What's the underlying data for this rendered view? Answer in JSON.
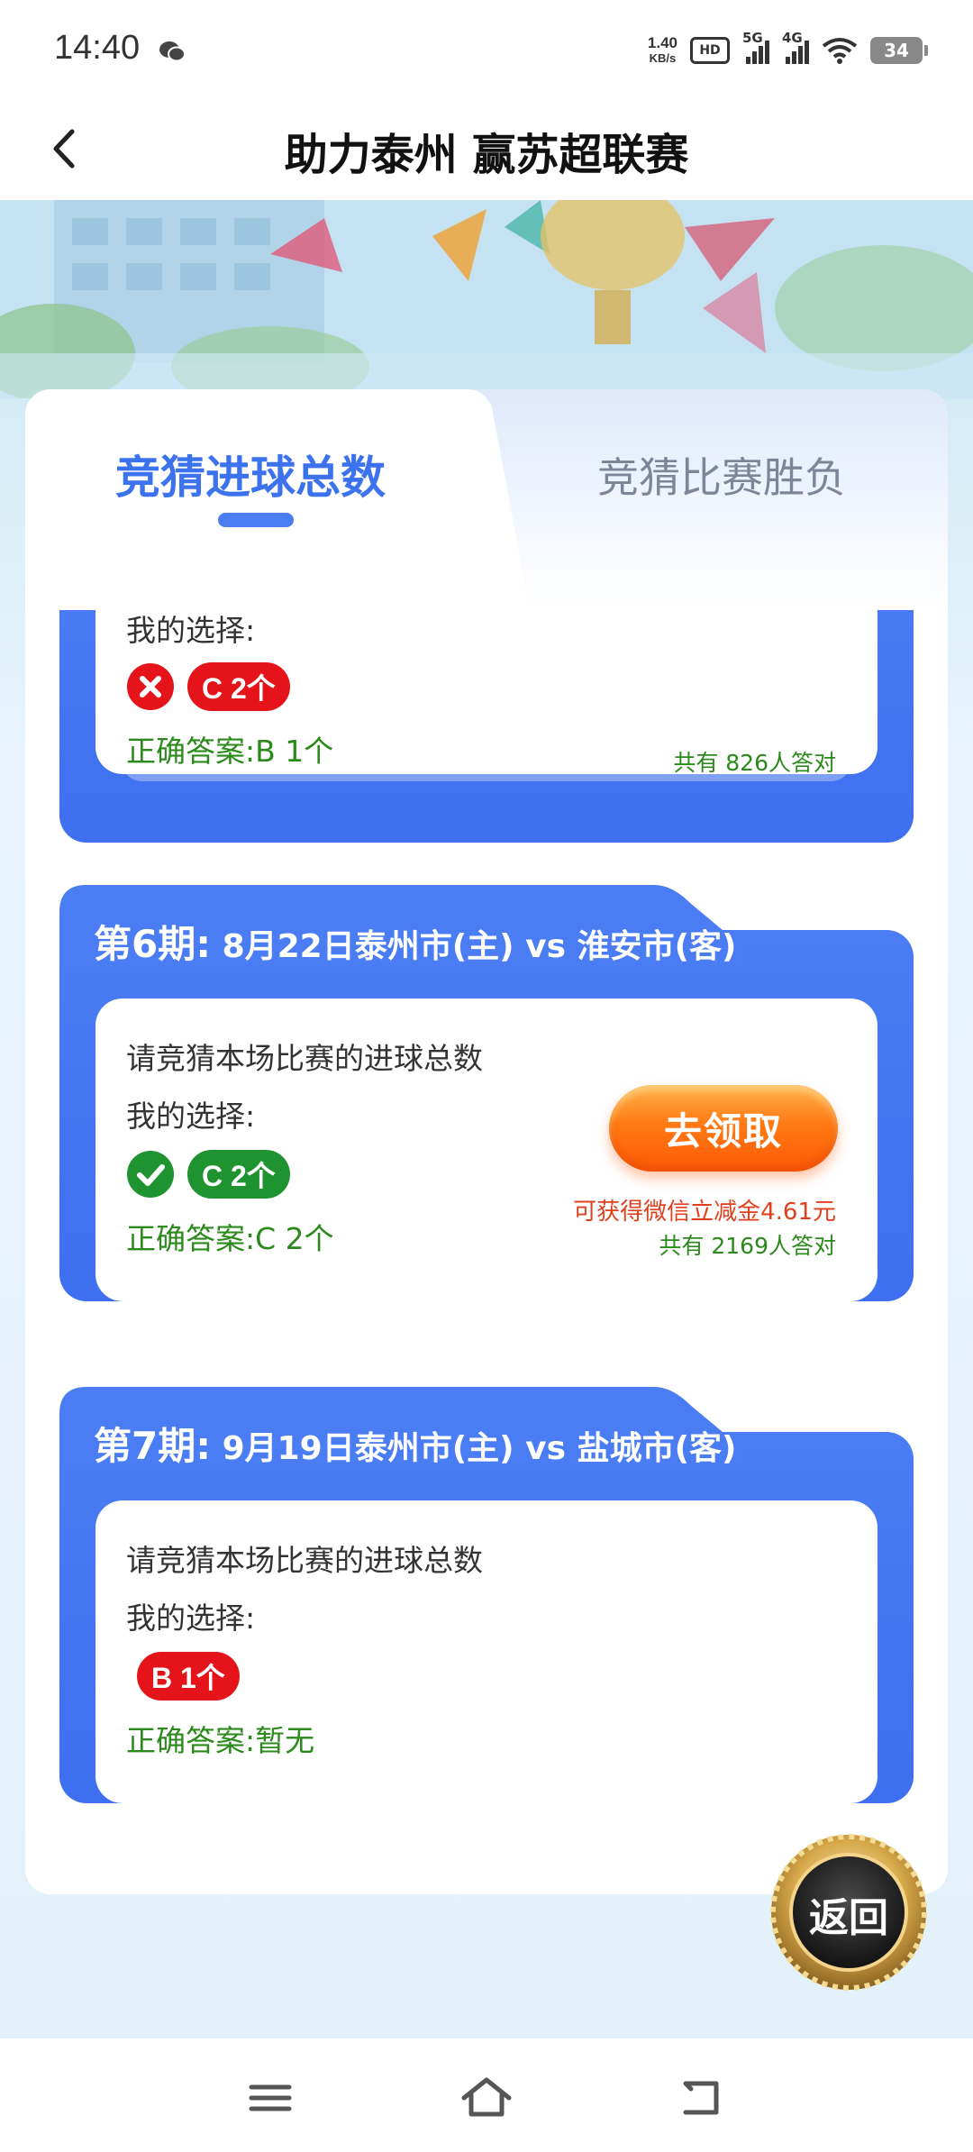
{
  "status_bar": {
    "time": "14:40",
    "net_speed_value": "1.40",
    "net_speed_unit": "KB/s",
    "hd_label": "HD",
    "signal_1": "5G",
    "signal_2": "4G",
    "battery": "34"
  },
  "header": {
    "title": "助力泰州 赢苏超联赛",
    "back_icon": "chevron-left-icon"
  },
  "tabs": [
    {
      "label": "竞猜进球总数",
      "active": true
    },
    {
      "label": "竞猜比赛胜负",
      "active": false
    }
  ],
  "periods": [
    {
      "title_num": "",
      "title_rest": "",
      "question": "",
      "my_choice_label": "我的选择:",
      "choice": "C 2个",
      "choice_result": "wrong",
      "correct_answer": "正确答案:B 1个",
      "stat": "共有 826人答对"
    },
    {
      "title_num": "第6期:",
      "title_rest": "8月22日泰州市(主) vs 淮安市(客)",
      "question": "请竞猜本场比赛的进球总数",
      "my_choice_label": "我的选择:",
      "choice": "C 2个",
      "choice_result": "right",
      "correct_answer": "正确答案:C 2个",
      "claim_button": "去领取",
      "reward": "可获得微信立减金4.61元",
      "stat": "共有 2169人答对"
    },
    {
      "title_num": "第7期:",
      "title_rest": "9月19日泰州市(主) vs 盐城市(客)",
      "question": "请竞猜本场比赛的进球总数",
      "my_choice_label": "我的选择:",
      "choice": "B 1个",
      "choice_result": "pending",
      "correct_answer": "正确答案:暂无"
    }
  ],
  "return_button": "返回",
  "colors": {
    "accent_blue": "#3d6ff0",
    "wrong_red": "#e5141a",
    "right_green": "#1e9330",
    "answer_green": "#2b8a1b",
    "reward_red": "#e0401e",
    "claim_orange": "#ff6a0a"
  }
}
